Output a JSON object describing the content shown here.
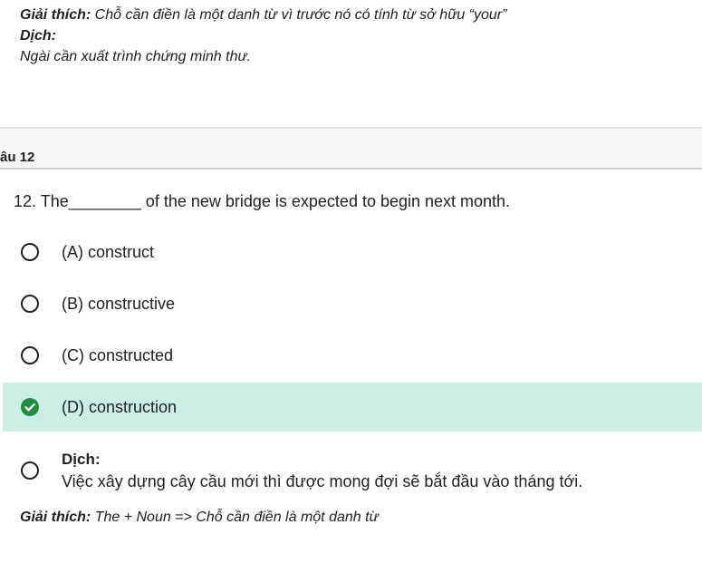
{
  "previous": {
    "explain_label": "Giải thích:",
    "explain_text": " Chỗ cần điền là một danh từ vì trước nó có tính từ sở hữu “your”",
    "translate_label": "Dịch:",
    "translate_text": "Ngài cần xuất trình chứng minh thư."
  },
  "section": {
    "title": "âu 12"
  },
  "question": {
    "text": "12. The________ of the new bridge is expected to begin next month."
  },
  "options": [
    {
      "label": "(A) construct",
      "state": "unselected"
    },
    {
      "label": "(B) constructive",
      "state": "unselected"
    },
    {
      "label": "(C) constructed",
      "state": "unselected"
    },
    {
      "label": "(D) construction",
      "state": "correct"
    }
  ],
  "answer_detail": {
    "translate_label": "Dịch:",
    "translate_text": "Việc xây dựng cây cầu mới thì được mong đợi sẽ bắt đầu vào tháng tới.",
    "explain_label": "Giải thích:",
    "explain_text": " The + Noun => Chỗ cần điền là một danh từ"
  },
  "colors": {
    "correct_bg": "#ccefe5",
    "check_green": "#1e8e3e",
    "header_bg": "#f6f6f4"
  },
  "icons": {
    "radio": "radio-empty-icon",
    "check": "check-circle-icon"
  }
}
